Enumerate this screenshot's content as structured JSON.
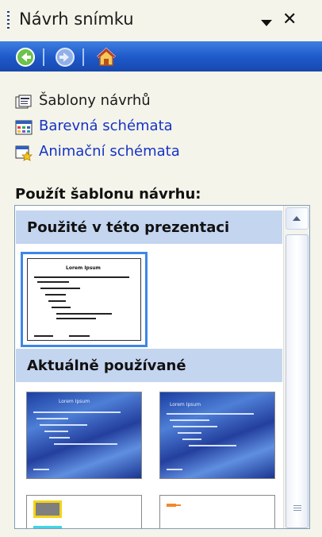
{
  "pane": {
    "title": "Návrh snímku"
  },
  "nav": {
    "back_icon": "back-arrow-icon",
    "forward_icon": "forward-arrow-icon",
    "home_icon": "home-icon",
    "accent": "#2a64d6"
  },
  "links": [
    {
      "label": "Šablony návrhů",
      "icon": "design-templates-icon",
      "color": "#1b1b1b"
    },
    {
      "label": "Barevná schémata",
      "icon": "color-schemes-icon",
      "color": "#1533c6"
    },
    {
      "label": "Animační schémata",
      "icon": "animation-schemes-icon",
      "color": "#1533c6"
    }
  ],
  "apply_label": "Použít šablonu návrhu:",
  "gallery": {
    "groups": [
      {
        "title": "Použité v této prezentaci"
      },
      {
        "title": "Aktuálně používané"
      }
    ],
    "thumbnail_title": "Lorem Ipsum"
  }
}
